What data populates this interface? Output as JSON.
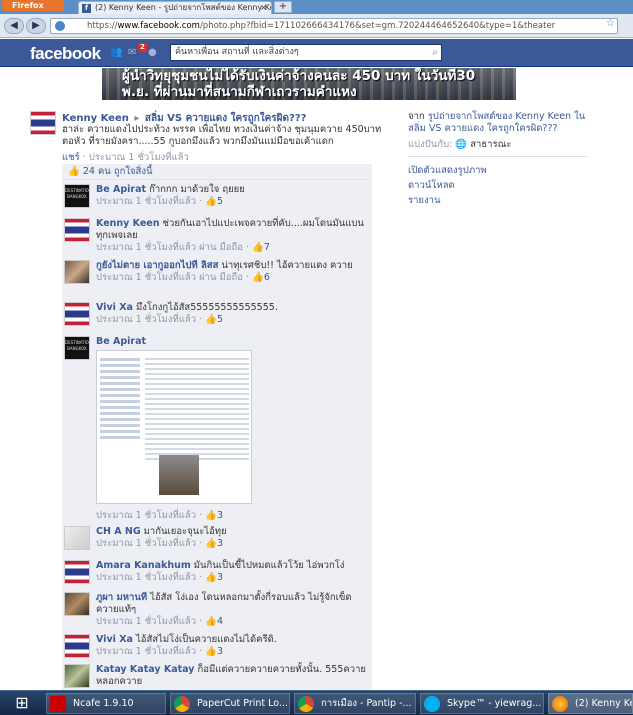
{
  "browser": {
    "menu_label": "Firefox",
    "tab_title": "(2) Kenny Keen - รูปถ่ายจากโพสต์ของ Kenny Keen ...",
    "tab_close": "×",
    "new_tab": "+",
    "url_prefix": "https://",
    "url_domain": "www.facebook.com",
    "url_rest": "/photo.php?fbid=171102666434176&set=gm.720244464652640&type=1&theater",
    "site_label": "facebook.com"
  },
  "facebook": {
    "logo": "facebook",
    "notif_count": "2",
    "search_placeholder": "ค้นหาเพื่อน สถานที่ และสิ่งต่างๆ"
  },
  "banner": {
    "line1": "ผู้นำวิทยุชุมชนไม่ได้รับเงินค่าจ้างคนละ 450 บาท ในวันที่30",
    "line2": "พ.ย. ที่ผ่านมาที่สนามกีฬาเถวรามคำแหง"
  },
  "post": {
    "author": "Kenny Keen",
    "arrow": "▸",
    "group": "สลิ่ม VS ควายแดง ใครถูกใครผิด???",
    "text": "ฮาล่ะ ควายแดงไปประท้วง พรรค เพื่อไทย ทวงเงินค่าจ้าง ชุมนุมควาย 450บาท ตอหัว ที่รายมังครา.....55 กูบอกมึงแล้ว พวกมึงมันแม่มือขอเค้าแดก",
    "share_link": "แชร์",
    "time": "ประมาณ 1 ชั่วโมงที่แล้ว",
    "likes": "24 คน ถูกใจสิ่งนี้"
  },
  "comments": [
    {
      "name": "Be Apirat",
      "text": "ก๊ากกก มาด้วยใจ ฤยยย",
      "time": "ประมาณ 1 ชั่วโมงที่แล้ว",
      "via": "",
      "likes": "5"
    },
    {
      "name": "Kenny Keen",
      "text": "ช่วยกันเอาไปแปะเพจควายที่คับ....ผมโดนมันแบนทุกเพจเลย",
      "time": "ประมาณ 1 ชั่วโมงที่แล้ว",
      "via": "ผ่าน มือถือ",
      "likes": "7"
    },
    {
      "name": "กูยังไม่ตาย เอากูออกไปที ลิสส",
      "text": "น่าทุเรศชิบ!! ไอ้ควายแดง ควาย",
      "time": "ประมาณ 1 ชั่วโมงที่แล้ว",
      "via": "ผ่าน มือถือ",
      "likes": "6"
    },
    {
      "name": "Vivi Xa",
      "text": "มึงโกงกูไอ้สัส55555555555555.",
      "time": "ประมาณ 1 ชั่วโมงที่แล้ว",
      "via": "",
      "likes": "5"
    },
    {
      "name": "Be Apirat",
      "text": "",
      "time": "ประมาณ 1 ชั่วโมงที่แล้ว",
      "via": "",
      "likes": "3"
    },
    {
      "name": "CH A NG",
      "text": "มากันเยอะจุนะไอ้ทุย",
      "time": "ประมาณ 1 ชั่วโมงที่แล้ว",
      "via": "",
      "likes": "3"
    },
    {
      "name": "Amara Kanakhum",
      "text": "มันกินเป็นขี้ไปหมดแล้วโว้ย ไอ่พวกโง่",
      "time": "ประมาณ 1 ชั่วโมงที่แล้ว",
      "via": "",
      "likes": "3"
    },
    {
      "name": "ภูผา มหานที",
      "text": "ไอ้สัส โง่เอง โดนหลอกมาตั้งกี่รอบแล้ว ไม่รู้จักเข็ด ควายแท้ๆ",
      "time": "ประมาณ 1 ชั่วโมงที่แล้ว",
      "via": "",
      "likes": "4"
    },
    {
      "name": "Vivi Xa",
      "text": "ไอ้สัสไม่โง่เป็นควายแดงไม่ได้ครีดิ.",
      "time": "ประมาณ 1 ชั่วโมงที่แล้ว",
      "via": "",
      "likes": "3"
    },
    {
      "name": "Katay Katay Katay",
      "text": "ก็อมีแต่ควายควายควายทั้งนั้น. 555ควายหลอกควาย",
      "time": "",
      "via": "",
      "likes": ""
    }
  ],
  "right_panel": {
    "from_prefix": "จาก",
    "from_link": "รูปถ่ายจากโพสต์ของ Kenny Keen ใน สลิ่ม VS ควายแดง ใครถูกใครผิด???",
    "share_label": "แบ่งปันกับ:",
    "share_value": "สาธารณะ",
    "links": [
      "เปิดตัวแสดงรูปภาพ",
      "ดาวน์โหลด",
      "รายงาน"
    ]
  },
  "taskbar": {
    "items": [
      "Ncafe 1.9.10",
      "PaperCut Print Lo...",
      "การเมือง - Pantip -...",
      "Skype™ - yiewrag...",
      "(2) Kenny Ke..."
    ]
  },
  "colors": {
    "facebook_blue": "#3b5998",
    "link": "#3b5998",
    "comment_bg": "#edeff4"
  }
}
